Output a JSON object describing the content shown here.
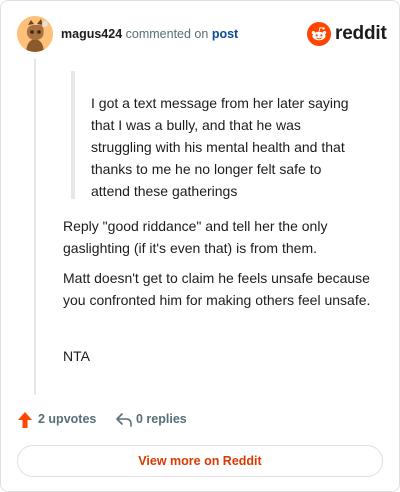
{
  "comment": {
    "author": "magus424",
    "action_text": "commented on",
    "post_link": "post",
    "brand": "reddit",
    "quote": "I got a text message from her later saying that I was a bully, and that he was struggling with his mental health and that thanks to me he no longer felt safe to attend these gatherings",
    "paragraphs": [
      "Reply \"good riddance\" and tell her the only gaslighting (if it's even that) is from them.",
      "Matt doesn't get to claim he feels unsafe because you confronted him for making others feel unsafe.",
      "NTA"
    ]
  },
  "actions": {
    "upvotes": "2 upvotes",
    "replies": "0 replies"
  },
  "footer": {
    "view_more": "View more on Reddit"
  },
  "colors": {
    "brand_orange": "#ff4500",
    "link_blue": "#0a4b9e",
    "view_more_text": "#d93a00",
    "muted": "#576f76"
  },
  "icons": {
    "avatar": "snoo-avatar-icon",
    "brand": "reddit-logo-icon",
    "upvote": "upvote-arrow-icon",
    "reply": "reply-arrow-icon"
  }
}
